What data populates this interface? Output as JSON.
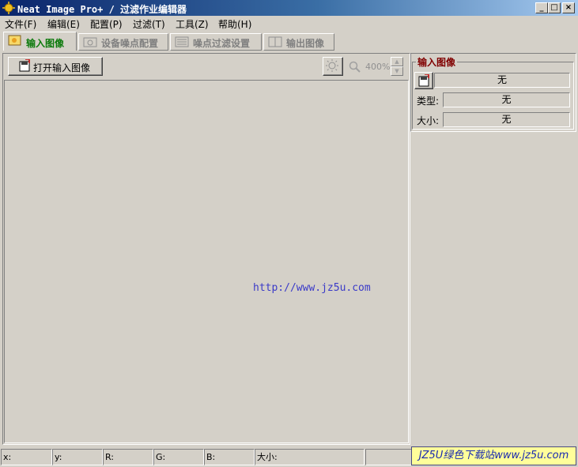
{
  "window": {
    "title": "Neat Image Pro+ / 过滤作业编辑器",
    "minimize": "_",
    "maximize": "□",
    "close": "×"
  },
  "menu": [
    {
      "label": "文件(F)"
    },
    {
      "label": "编辑(E)"
    },
    {
      "label": "配置(P)"
    },
    {
      "label": "过滤(T)"
    },
    {
      "label": "工具(Z)"
    },
    {
      "label": "帮助(H)"
    }
  ],
  "tabs": [
    {
      "label": "输入图像",
      "icon": "input-image-icon",
      "active": true
    },
    {
      "label": "设备噪点配置",
      "icon": "camera-icon",
      "active": false
    },
    {
      "label": "噪点过滤设置",
      "icon": "filter-settings-icon",
      "active": false
    },
    {
      "label": "输出图像",
      "icon": "output-image-icon",
      "active": false
    }
  ],
  "toolbar": {
    "open_label": "打开输入图像",
    "zoom": "400%"
  },
  "canvas": {
    "watermark_url": "http://www.jz5u.com"
  },
  "input_panel": {
    "title": "输入图像",
    "file_value": "无",
    "type_label": "类型:",
    "type_value": "无",
    "size_label": "大小:",
    "size_value": "无"
  },
  "statusbar": {
    "x": "x:",
    "y": "y:",
    "r": "R:",
    "g": "G:",
    "b": "B:",
    "size": "大小:",
    "banner": "JZ5U绿色下载站www.jz5u.com"
  },
  "colors": {
    "titlebar": "#0a246a",
    "active_tab": "#0c7a0c",
    "group_title": "#800000",
    "url": "#3a3ac8"
  }
}
